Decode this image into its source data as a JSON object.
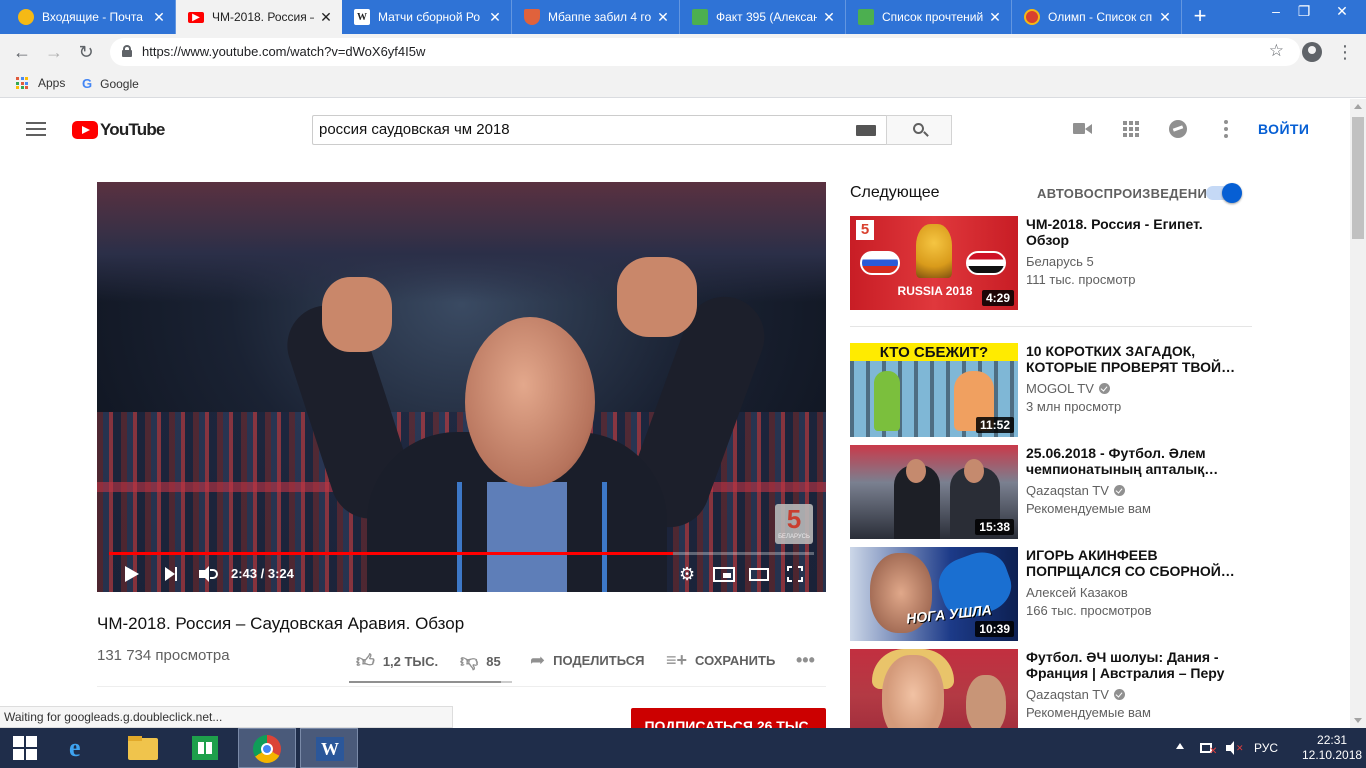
{
  "browser": {
    "tabs": [
      {
        "label": "Входящие - Почта",
        "favicon": "mail-icon",
        "color": "#f5b915"
      },
      {
        "label": "ЧМ-2018. Россия –",
        "favicon": "youtube-icon",
        "color": "#ff0000",
        "active": true
      },
      {
        "label": "Матчи сборной Ро",
        "favicon": "wikipedia-icon",
        "color": "#ffffff"
      },
      {
        "label": "Мбаппе забил 4 го",
        "favicon": "shield-icon",
        "color": "#e0623c"
      },
      {
        "label": "Факт 395 (Алексан",
        "favicon": "sheet-icon",
        "color": "#4caf50"
      },
      {
        "label": "Список прочтений",
        "favicon": "sheet-icon",
        "color": "#4caf50"
      },
      {
        "label": "Олимп - Список сп",
        "favicon": "olimp-icon",
        "color": "#d9412f"
      }
    ],
    "tab_close": "✕",
    "new_tab": "+",
    "url": "https://www.youtube.com/watch?v=dWoX6yf4I5w",
    "bookmarks": [
      {
        "label": "Apps"
      },
      {
        "label": "Google"
      }
    ],
    "status": "Waiting for googleads.g.doubleclick.net..."
  },
  "youtube": {
    "logo": "YouTube",
    "search_query": "россия саудовская чм 2018",
    "signin": "ВОЙТИ",
    "video": {
      "title": "ЧМ-2018. Россия – Саудовская Аравия. Обзор",
      "views": "131 734 просмотра",
      "time": "2:43 / 3:24",
      "progress": 0.8,
      "channel_bug": "5",
      "channel_bug_sub": "БЕЛАРУСЬ",
      "likes": "1,2 ТЫС.",
      "dislikes": "85",
      "share": "ПОДЕЛИТЬСЯ",
      "save": "СОХРАНИТЬ",
      "like_ratio": 0.93,
      "subscribe": "ПОДПИСАТЬСЯ  26 ТЫС."
    },
    "sidebar": {
      "up_next": "Следующее",
      "autoplay": "АВТОВОСПРОИЗВЕДЕНИЕ",
      "items": [
        {
          "title": "ЧМ-2018. Россия - Египет. Обзор",
          "channel": "Беларусь 5",
          "meta": "111 тыс. просмотр",
          "duration": "4:29",
          "verified": false,
          "thumb_text": "RUSSIA 2018"
        },
        {
          "title": "10 КОРОТКИХ ЗАГАДОК, КОТОРЫЕ ПРОВЕРЯТ ТВОЙ…",
          "channel": "MOGOL TV",
          "meta": "3 млн просмотр",
          "duration": "11:52",
          "verified": true,
          "thumb_text": "КТО СБЕЖИТ?"
        },
        {
          "title": "25.06.2018 - Футбол. Әлем чемпионатының апталық…",
          "channel": "Qazaqstan TV",
          "meta": "Рекомендуемые вам",
          "duration": "15:38",
          "verified": true,
          "thumb_text": ""
        },
        {
          "title": "ИГОРЬ АКИНФЕЕВ ПОПРЩАЛСЯ СО СБОРНОЙ…",
          "channel": "Алексей Казаков",
          "meta": "166 тыс. просмотров",
          "duration": "10:39",
          "verified": false,
          "thumb_text": "НОГА УШЛА"
        },
        {
          "title": "Футбол. ӘЧ шолуы: Дания - Франция | Австралия – Перу …",
          "channel": "Qazaqstan TV",
          "meta": "Рекомендуемые вам",
          "duration": "",
          "verified": true,
          "thumb_text": ""
        }
      ]
    }
  },
  "taskbar": {
    "apps": [
      "start-button",
      "internet-explorer-icon",
      "file-explorer-icon",
      "store-icon",
      "chrome-icon",
      "word-icon"
    ],
    "lang": "РУС",
    "time": "22:31",
    "date": "12.10.2018"
  },
  "colors": {
    "chrome_tabstrip": "#2f73d6",
    "youtube_red": "#ff0000",
    "link_blue": "#065fd4",
    "taskbar": "#1f2d4a"
  }
}
